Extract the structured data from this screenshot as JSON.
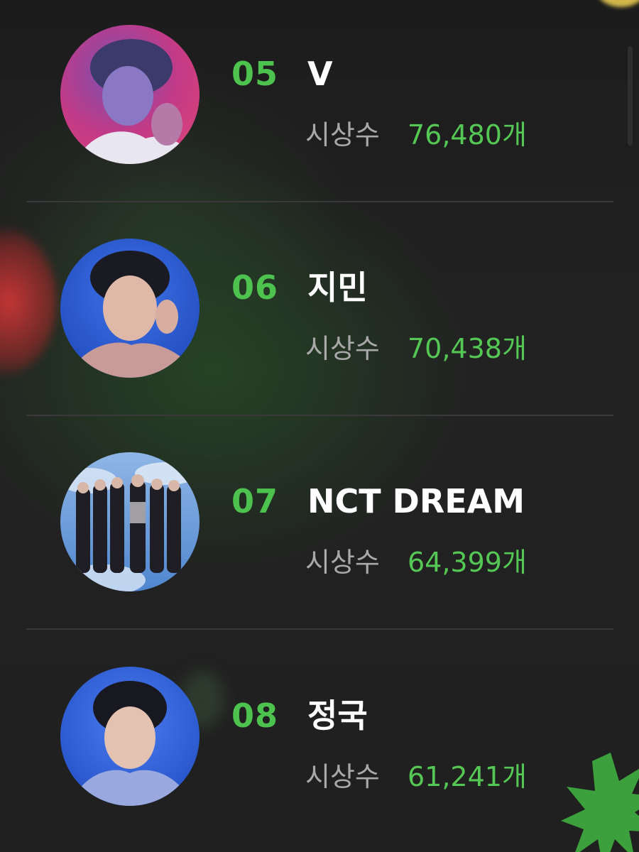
{
  "ranking": {
    "items": [
      {
        "rank": "05",
        "artist": "V",
        "stat_label": "시상수",
        "stat_value": "76,480개",
        "avatar_bg": "#c8357a"
      },
      {
        "rank": "06",
        "artist": "지민",
        "stat_label": "시상수",
        "stat_value": "70,438개",
        "avatar_bg": "#2a5fd6"
      },
      {
        "rank": "07",
        "artist": "NCT DREAM",
        "stat_label": "시상수",
        "stat_value": "64,399개",
        "avatar_bg": "#7aa7dc"
      },
      {
        "rank": "08",
        "artist": "정국",
        "stat_label": "시상수",
        "stat_value": "61,241개",
        "avatar_bg": "#2f62d8"
      }
    ]
  },
  "colors": {
    "accent_green": "#4ec24e",
    "value_green": "#55c755",
    "label_gray": "#a9a9a9",
    "background": "#1f1f1f",
    "divider": "#3a3a3a"
  }
}
